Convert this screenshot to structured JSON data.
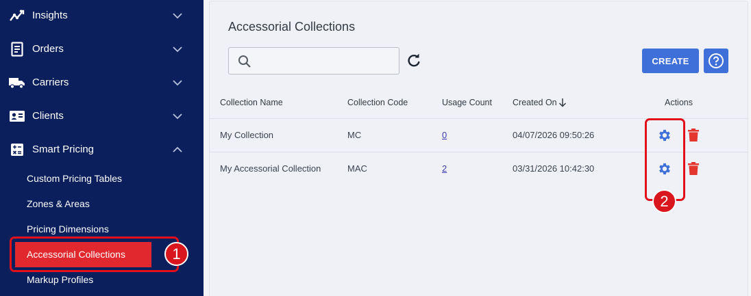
{
  "sidebar": {
    "items": [
      {
        "label": "Insights",
        "icon": "insights-icon",
        "expanded": false
      },
      {
        "label": "Orders",
        "icon": "orders-icon",
        "expanded": false
      },
      {
        "label": "Carriers",
        "icon": "truck-icon",
        "expanded": false
      },
      {
        "label": "Clients",
        "icon": "id-card-icon",
        "expanded": false
      },
      {
        "label": "Smart Pricing",
        "icon": "calculator-icon",
        "expanded": true
      }
    ],
    "sub_items": [
      {
        "label": "Custom Pricing Tables"
      },
      {
        "label": "Zones & Areas"
      },
      {
        "label": "Pricing Dimensions"
      },
      {
        "label": "Accessorial Collections",
        "active": true
      },
      {
        "label": "Markup Profiles"
      }
    ]
  },
  "main": {
    "title": "Accessorial Collections",
    "search": {
      "value": "",
      "placeholder": ""
    },
    "create_label": "CREATE",
    "table": {
      "headers": {
        "name": "Collection Name",
        "code": "Collection Code",
        "usage": "Usage Count",
        "created": "Created On",
        "actions": "Actions"
      },
      "rows": [
        {
          "name": "My Collection",
          "code": "MC",
          "usage": "0",
          "created": "04/07/2026 09:50:26"
        },
        {
          "name": "My Accessorial Collection",
          "code": "MAC",
          "usage": "2",
          "created": "03/31/2026 10:42:30"
        }
      ]
    }
  },
  "annotations": {
    "badge_1": "1",
    "badge_2": "2"
  },
  "colors": {
    "sidebar_bg": "#0a1f5c",
    "active_bg": "#e0282e",
    "primary": "#3f6fd8",
    "delete": "#e5352f",
    "annotation": "#e3101a"
  }
}
